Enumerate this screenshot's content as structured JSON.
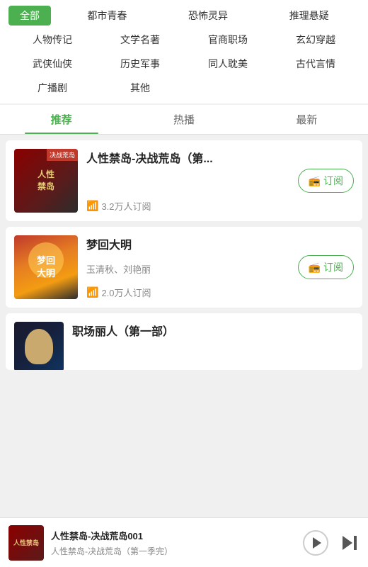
{
  "categories": {
    "rows": [
      [
        {
          "label": "全部",
          "active": true
        },
        {
          "label": "都市青春",
          "active": false
        },
        {
          "label": "恐怖灵异",
          "active": false
        },
        {
          "label": "推理悬疑",
          "active": false
        }
      ],
      [
        {
          "label": "人物传记",
          "active": false
        },
        {
          "label": "文学名著",
          "active": false
        },
        {
          "label": "官商职场",
          "active": false
        },
        {
          "label": "玄幻穿越",
          "active": false
        }
      ],
      [
        {
          "label": "武侠仙侠",
          "active": false
        },
        {
          "label": "历史军事",
          "active": false
        },
        {
          "label": "同人耽美",
          "active": false
        },
        {
          "label": "古代言情",
          "active": false
        }
      ],
      [
        {
          "label": "广播剧",
          "active": false
        },
        {
          "label": "其他",
          "active": false
        }
      ]
    ]
  },
  "tabs": [
    {
      "label": "推荐",
      "active": true
    },
    {
      "label": "热播",
      "active": false
    },
    {
      "label": "最新",
      "active": false
    }
  ],
  "books": [
    {
      "title": "人性禁岛-决战荒岛（第...",
      "author": "",
      "subscribers": "3.2万人订阅",
      "subscribe_btn": "订阅"
    },
    {
      "title": "梦回大明",
      "author": "玉清秋、刘艳丽",
      "subscribers": "2.0万人订阅",
      "subscribe_btn": "订阅"
    },
    {
      "title": "职场丽人（第一部）",
      "author": "",
      "subscribers": "",
      "subscribe_btn": ""
    }
  ],
  "player": {
    "title": "人性禁岛-决战荒岛001",
    "subtitle": "人性禁岛-决战荒岛（第一季完）"
  },
  "icons": {
    "subscribe": "📻",
    "signal": "📶",
    "play": "▶",
    "next": "⏭"
  }
}
